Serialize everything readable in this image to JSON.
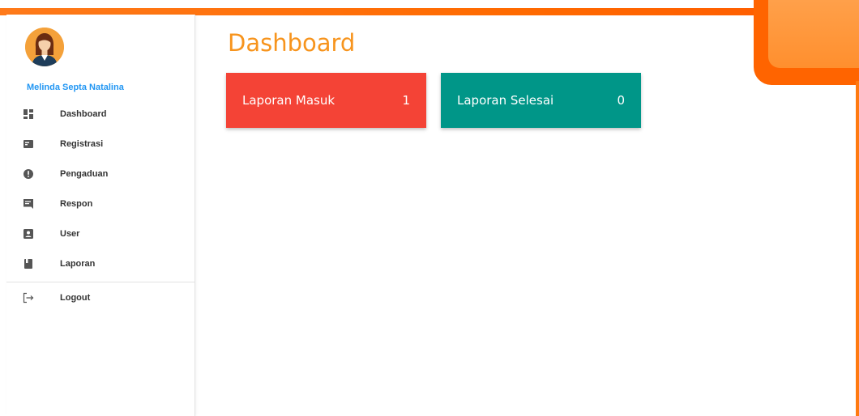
{
  "user": {
    "name": "Melinda Septa Natalina"
  },
  "page": {
    "title": "Dashboard"
  },
  "menu": {
    "items": [
      {
        "label": "Dashboard",
        "icon": "dashboard-icon"
      },
      {
        "label": "Registrasi",
        "icon": "card-icon"
      },
      {
        "label": "Pengaduan",
        "icon": "alert-icon"
      },
      {
        "label": "Respon",
        "icon": "chat-icon"
      },
      {
        "label": "User",
        "icon": "account-box-icon"
      },
      {
        "label": "Laporan",
        "icon": "book-icon"
      }
    ],
    "logout": {
      "label": "Logout",
      "icon": "logout-icon"
    }
  },
  "cards": [
    {
      "label": "Laporan Masuk",
      "value": "1",
      "color": "#f44336"
    },
    {
      "label": "Laporan Selesai",
      "value": "0",
      "color": "#009688"
    }
  ],
  "colors": {
    "accent_orange": "#f7941d",
    "frame_orange": "#ff6400",
    "link_blue": "#2196f3"
  }
}
